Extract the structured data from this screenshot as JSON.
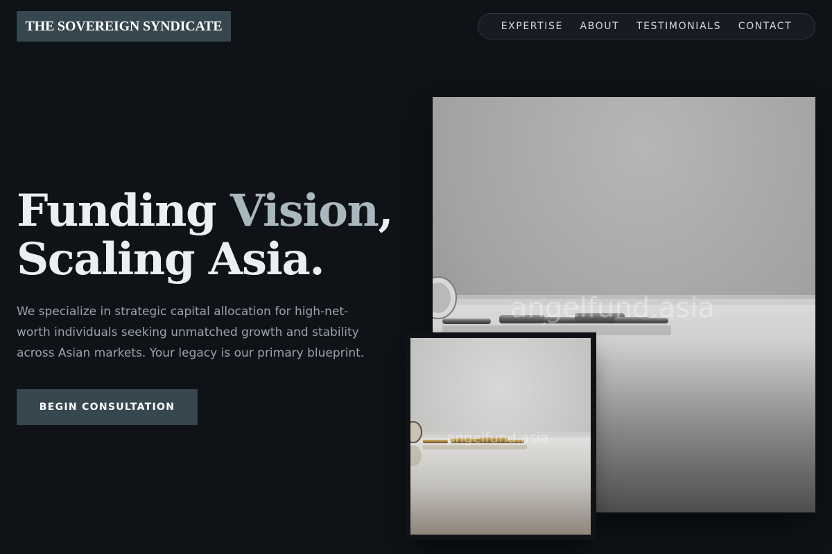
{
  "brand": {
    "name": "THE SOVEREIGN SYNDICATE"
  },
  "nav": {
    "items": [
      {
        "label": "EXPERTISE"
      },
      {
        "label": "ABOUT"
      },
      {
        "label": "TESTIMONIALS"
      },
      {
        "label": "CONTACT"
      }
    ]
  },
  "hero": {
    "headline_part1": "Funding ",
    "headline_accent": "Vision",
    "headline_part2": ",",
    "headline_line2": "Scaling Asia.",
    "description": "We specialize in strategic capital allocation for high-net-worth individuals seeking unmatched growth and stability across Asian markets. Your legacy is our primary blueprint.",
    "cta_label": "BEGIN CONSULTATION"
  },
  "images": {
    "large": {
      "subject": "coins on reflective surface",
      "watermark": "angelfund.asia"
    },
    "small": {
      "subject": "coins on reflective surface",
      "watermark": "angelfund.asia"
    }
  },
  "colors": {
    "background": "#0f1317",
    "accent_block": "#37474f",
    "headline": "#eceff1",
    "headline_accent": "#a9b7be",
    "body_text": "#9aa4ab"
  }
}
